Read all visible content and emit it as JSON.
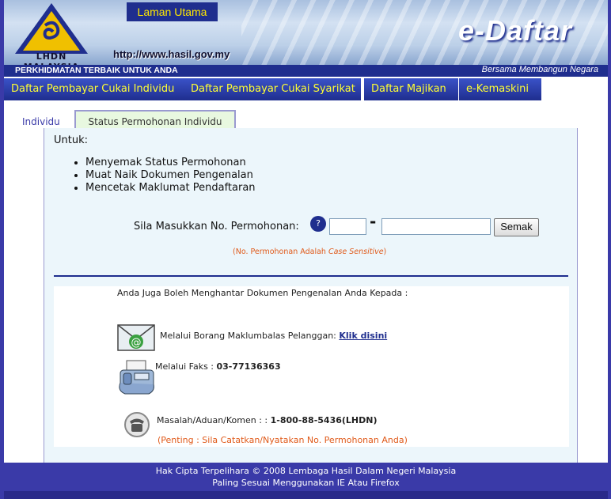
{
  "header": {
    "home_label": "Laman Utama",
    "logo_text": "LHDN MALAYSIA",
    "url": "http://www.hasil.gov.my",
    "brand": "e-Daftar",
    "tagline_left": "PERKHIDMATAN TERBAIK UNTUK ANDA",
    "tagline_right": "Bersama Membangun Negara"
  },
  "nav": {
    "items": [
      {
        "label": "Daftar Pembayar Cukai Individu"
      },
      {
        "label": "Daftar Pembayar Cukai Syarikat"
      },
      {
        "label": "Daftar Majikan"
      },
      {
        "label": "e-Kemaskini"
      }
    ]
  },
  "tabs": {
    "inactive": "Individu",
    "active": "Status Permohonan Individu"
  },
  "content": {
    "intro": "Untuk:",
    "bullets": [
      "Menyemak Status Permohonan",
      "Muat Naik Dokumen Pengenalan",
      "Mencetak Maklumat Pendaftaran"
    ],
    "prompt": "Sila Masukkan No. Permohonan:",
    "help_icon_glyph": "?",
    "dash": "-",
    "button": "Semak",
    "note_prefix": "(No. Permohonan Adalah ",
    "note_italic": "Case Sensitive",
    "note_suffix": ")"
  },
  "contact": {
    "title": "Anda Juga Boleh Menghantar Dokumen Pengenalan Anda Kepada :",
    "mail_text": "Melalui Borang Maklumbalas Pelanggan: ",
    "mail_link": "Klik disini",
    "fax_label": "Melalui Faks : ",
    "fax_number": "03-77136363",
    "phone_label": "Masalah/Aduan/Komen : : ",
    "phone_number": "1-800-88-5436(LHDN)",
    "important": "(Penting : Sila Catatkan/Nyatakan No. Permohonan Anda)"
  },
  "footer": {
    "line1": "Hak Cipta Terpelihara © 2008 Lembaga Hasil Dalam Negeri Malaysia",
    "line2": "Paling Sesuai Menggunakan IE Atau Firefox"
  },
  "colors": {
    "navy": "#1f2e8e",
    "nav_text": "#ffff33",
    "accent_orange": "#e05a1a",
    "panel_bg": "#ecf6fb"
  }
}
